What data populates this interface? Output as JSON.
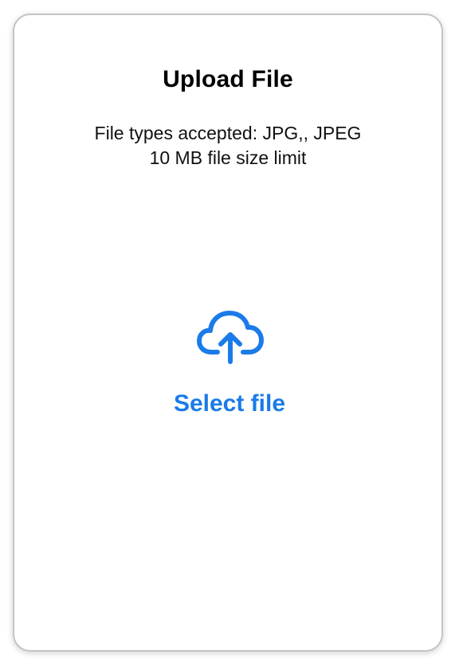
{
  "dialog": {
    "title": "Upload File",
    "accepted_types": "File types accepted: JPG,, JPEG",
    "size_limit": "10 MB file size limit"
  },
  "upload": {
    "icon": "cloud-upload-icon",
    "label": "Select file",
    "accent_color": "#1b7be8"
  }
}
